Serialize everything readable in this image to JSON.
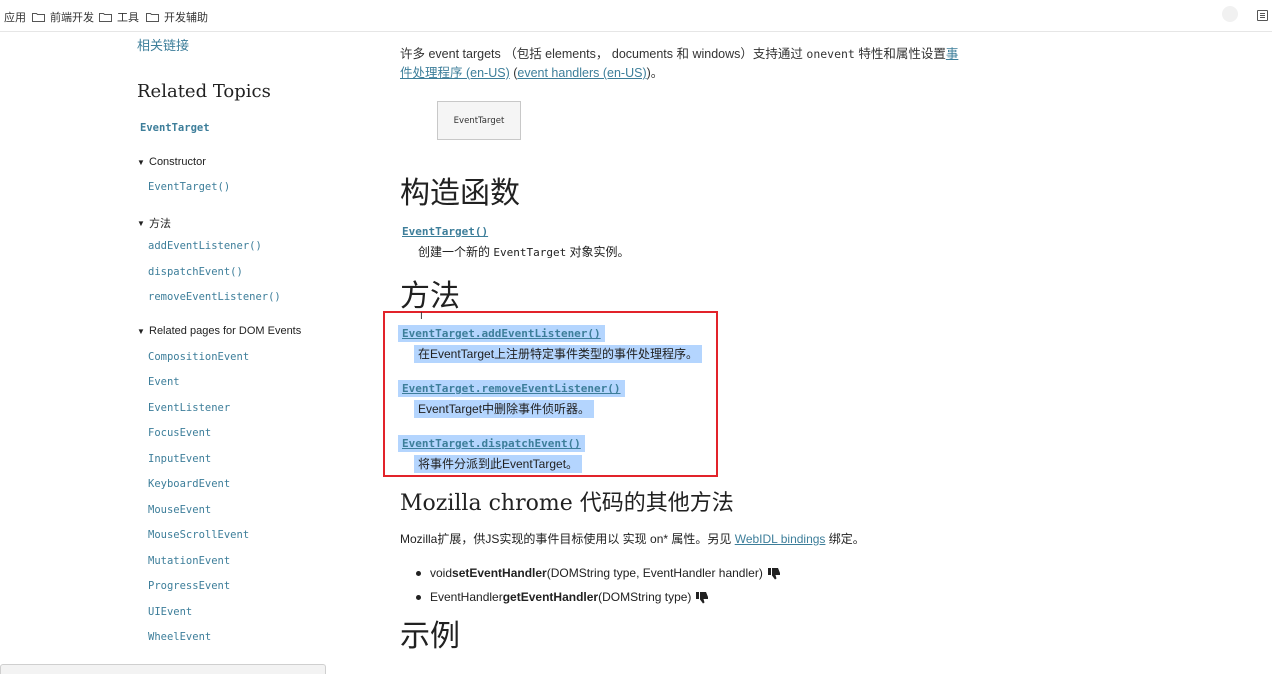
{
  "bookmarks": {
    "items": [
      {
        "label": "应用"
      },
      {
        "label": "前端开发"
      },
      {
        "label": "工具"
      },
      {
        "label": "开发辅助"
      }
    ]
  },
  "sidebar": {
    "related_links": "相关链接",
    "related_topics": "Related Topics",
    "event_target": "EventTarget",
    "groups": [
      {
        "title": "Constructor",
        "items": [
          "EventTarget()"
        ]
      },
      {
        "title": "方法",
        "items": [
          "addEventListener()",
          "dispatchEvent()",
          "removeEventListener()"
        ]
      },
      {
        "title": "Related pages for DOM Events",
        "items": [
          "CompositionEvent",
          "Event",
          "EventListener",
          "FocusEvent",
          "InputEvent",
          "KeyboardEvent",
          "MouseEvent",
          "MouseScrollEvent",
          "MutationEvent",
          "ProgressEvent",
          "UIEvent",
          "WheelEvent"
        ]
      }
    ]
  },
  "main": {
    "intro": {
      "part1": "许多 event targets （包括 elements， documents 和 windows）支持通过 ",
      "code": "onevent",
      "part2": " 特性和属性设置",
      "link1": "事件处理程序 (en-US)",
      "part3": " (",
      "link2": "event handlers (en-US)",
      "part4": ")。"
    },
    "diagram_label": "EventTarget",
    "constructor_heading": "构造函数",
    "constructor": {
      "name": "EventTarget()",
      "desc_prefix": "创建一个新的 ",
      "desc_code": "EventTarget",
      "desc_suffix": " 对象实例。"
    },
    "methods_heading": "方法",
    "methods": [
      {
        "name": "EventTarget.addEventListener()",
        "desc": "在EventTarget上注册特定事件类型的事件处理程序。"
      },
      {
        "name": "EventTarget.removeEventListener()",
        "desc": "EventTarget中删除事件侦听器。"
      },
      {
        "name": "EventTarget.dispatchEvent()",
        "desc": "将事件分派到此EventTarget。"
      }
    ],
    "mozilla_heading": "Mozilla chrome 代码的其他方法",
    "mozilla_para": {
      "part1": "Mozilla扩展，供JS实现的事件目标使用以 实现 on* 属性。另见 ",
      "link": "WebIDL bindings",
      "part2": " 绑定。"
    },
    "bullets": [
      {
        "prefix": "void ",
        "bold": "setEventHandler",
        "suffix": "(DOMString type, EventHandler handler)"
      },
      {
        "prefix": "EventHandler ",
        "bold": "getEventHandler",
        "suffix": "(DOMString type)"
      }
    ],
    "examples_heading": "示例"
  },
  "colors": {
    "link": "#3d7e9a",
    "selection": "#b4d5fe",
    "highlight_border": "#e2232a"
  }
}
